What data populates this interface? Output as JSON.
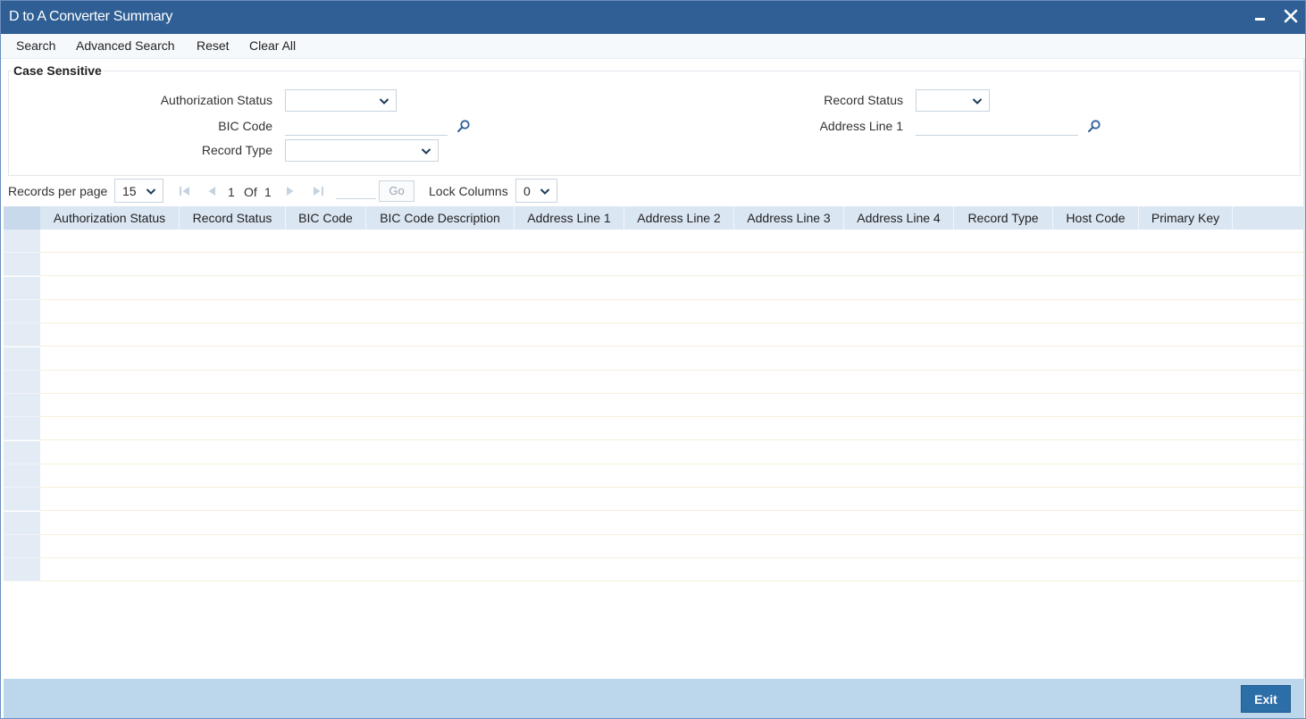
{
  "window": {
    "title": "D to A Converter Summary",
    "minimize_icon": "minimize-icon",
    "close_icon": "close-icon"
  },
  "toolbar": {
    "search": "Search",
    "advanced_search": "Advanced Search",
    "reset": "Reset",
    "clear_all": "Clear All"
  },
  "criteria": {
    "legend": "Case Sensitive",
    "authorization_status": {
      "label": "Authorization Status",
      "value": ""
    },
    "record_status": {
      "label": "Record Status",
      "value": ""
    },
    "bic_code": {
      "label": "BIC Code",
      "value": "",
      "icon": "search-icon"
    },
    "address_line_1": {
      "label": "Address Line 1",
      "value": "",
      "icon": "search-icon"
    },
    "record_type": {
      "label": "Record Type",
      "value": ""
    }
  },
  "pager": {
    "records_per_page_label": "Records per page",
    "records_per_page": "15",
    "current_page": "1",
    "of_label": "Of",
    "total_pages": "1",
    "go_label": "Go",
    "lock_columns_label": "Lock Columns",
    "lock_columns": "0"
  },
  "grid": {
    "columns": [
      "Authorization Status",
      "Record Status",
      "BIC Code",
      "BIC Code Description",
      "Address Line 1",
      "Address Line 2",
      "Address Line 3",
      "Address Line 4",
      "Record Type",
      "Host Code",
      "Primary Key"
    ],
    "rows": 15
  },
  "footer": {
    "exit": "Exit"
  },
  "colors": {
    "titlebar": "#2f5f95",
    "footer": "#bcd7ec",
    "exit_button": "#2c6ea8",
    "grid_header": "#dbe6f3"
  }
}
